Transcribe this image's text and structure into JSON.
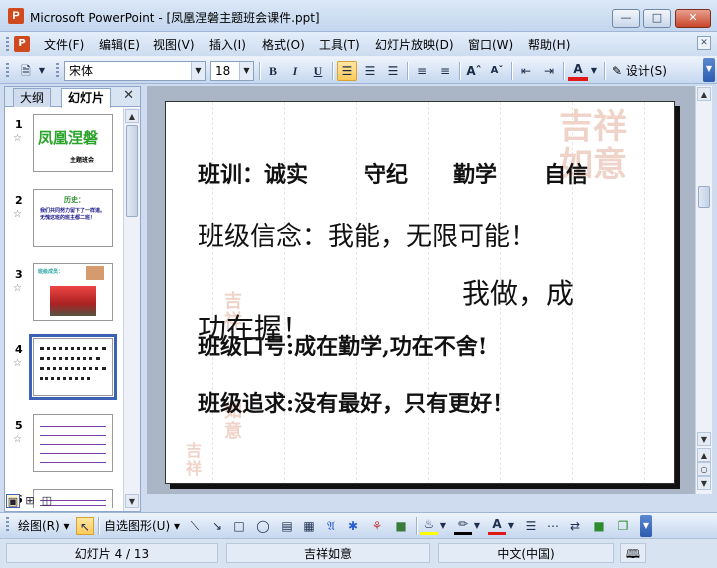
{
  "window": {
    "title": "Microsoft PowerPoint - [凤凰涅磐主题班会课件.ppt]",
    "app_icon": "P",
    "min_icon": "minimize-icon",
    "max_icon": "maximize-icon",
    "close_icon": "close-icon"
  },
  "menu": {
    "items": [
      "文件(F)",
      "编辑(E)",
      "视图(V)",
      "插入(I)",
      "格式(O)",
      "工具(T)",
      "幻灯片放映(D)",
      "窗口(W)",
      "帮助(H)"
    ]
  },
  "toolbar": {
    "font_name": "宋体",
    "font_size": "18",
    "bold": "B",
    "italic": "I",
    "underline": "U",
    "design_label": "设计(S)"
  },
  "panel": {
    "tabs": [
      "大纲",
      "幻灯片"
    ],
    "active_tab": "幻灯片",
    "slide_numbers": [
      "1",
      "2",
      "3",
      "4",
      "5",
      "6"
    ],
    "selected_slide": "4",
    "thumb1_title": "凤凰涅磐",
    "thumb1_subtitle": "主题班会",
    "thumb2_label": "历史：",
    "thumb2_body": "我们共同努力留下了一样道。无愧这班的班主都二班！",
    "thumb3_label": "班级成员："
  },
  "slide": {
    "line1_label": "班训：",
    "line1_items": [
      "诚实",
      "守纪",
      "勤学",
      "自信"
    ],
    "line2": "班级信念：我能，无限可能！",
    "line3a": "我做，成",
    "line3b": "功在握！",
    "line4": "班级口号:成在勤学,功在不舍!",
    "line5": "班级追求:没有最好，只有更好！",
    "watermark": "吉祥如意"
  },
  "drawing": {
    "draw_label": "绘图(R)",
    "autoshapes_label": "自选图形(U)"
  },
  "status": {
    "slide_info": "幻灯片 4 / 13",
    "design_name": "吉祥如意",
    "language": "中文(中国)"
  }
}
